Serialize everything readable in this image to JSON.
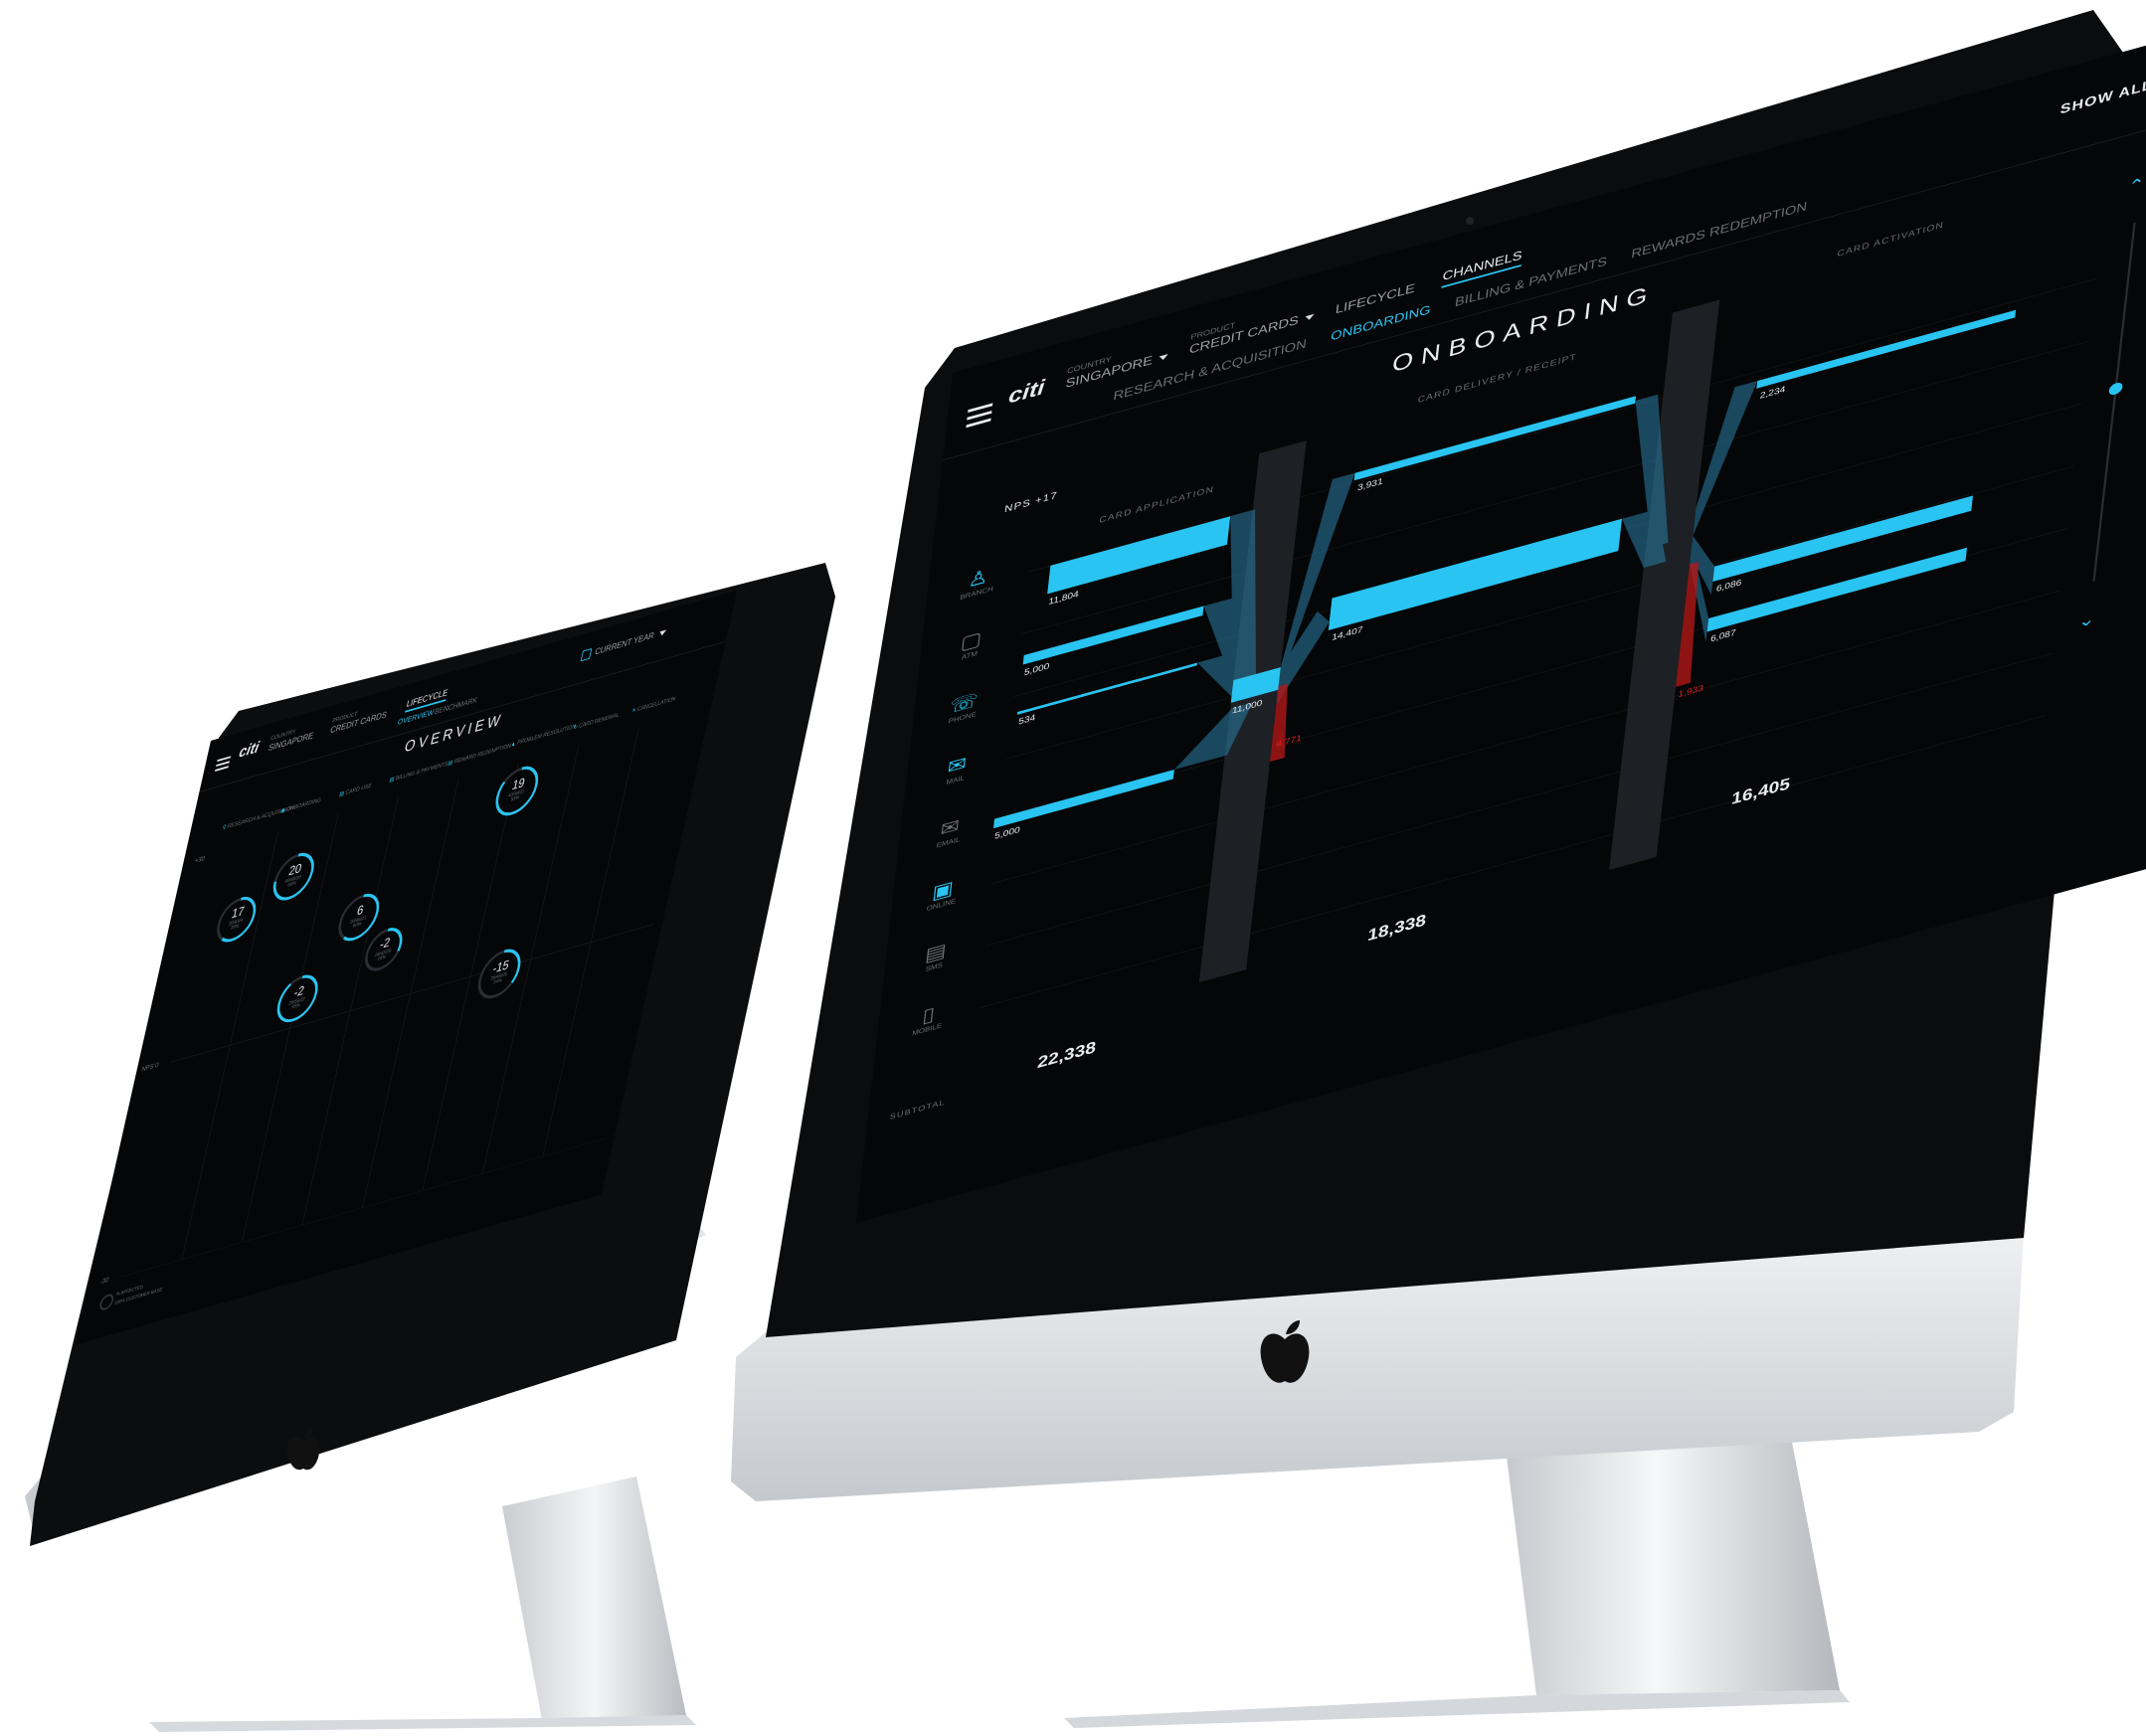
{
  "large": {
    "nav": {
      "country_label": "COUNTRY",
      "country_value": "SINGAPORE",
      "product_label": "PRODUCT",
      "product_value": "CREDIT CARDS",
      "lifecycle": "LIFECYCLE",
      "channels": "CHANNELS",
      "show_all": "SHOW ALL"
    },
    "tabs": [
      "RESEARCH & ACQUISITION",
      "ONBOARDING",
      "BILLING & PAYMENTS",
      "REWARDS REDEMPTION"
    ],
    "page_title": "ONBOARDING",
    "nps": "NPS +17",
    "stages": [
      "CARD APPLICATION",
      "CARD DELIVERY / RECEIPT",
      "CARD ACTIVATION"
    ],
    "channels": [
      {
        "icon": "branch-icon",
        "label": "BRANCH"
      },
      {
        "icon": "atm-icon",
        "label": "ATM"
      },
      {
        "icon": "phone-icon",
        "label": "PHONE"
      },
      {
        "icon": "mail-icon",
        "label": "MAIL"
      },
      {
        "icon": "email-icon",
        "label": "EMAIL"
      },
      {
        "icon": "online-icon",
        "label": "ONLINE"
      },
      {
        "icon": "sms-icon",
        "label": "SMS"
      },
      {
        "icon": "mobile-icon",
        "label": "MOBILE"
      }
    ],
    "bar_values": {
      "app_branch": "11,804",
      "app_phone": "5,000",
      "app_mail": "534",
      "app_online": "5,000",
      "app_pass": "11,000",
      "app_drop": "4,771",
      "delivery_top": "3,931",
      "delivery_main": "14,407",
      "act_branch": "2,234",
      "act_mid": "6,086",
      "act_low": "6,087",
      "act_drop": "1,933"
    },
    "subtotal_label": "SUBTOTAL",
    "subtotals": [
      "22,338",
      "18,338",
      "16,405"
    ],
    "colors": {
      "accent": "#29c4f2",
      "drop": "#e02020",
      "screen": "#050607"
    }
  },
  "small": {
    "nav": {
      "country_label": "COUNTRY",
      "country_value": "SINGAPORE",
      "product_label": "PRODUCT",
      "product_value": "CREDIT CARDS",
      "lifecycle": "LIFECYCLE",
      "period": "CURRENT YEAR"
    },
    "tabs": [
      "OVERVIEW",
      "BENCHMARK"
    ],
    "page_title": "OVERVIEW",
    "stages": [
      "RESEARCH & ACQUISITION",
      "ONBOARDING",
      "CARD USE",
      "BILLING & PAYMENTS",
      "REWARD REDEMPTION",
      "PROBLEM RESOLUTION",
      "CARD RENEWAL",
      "CANCELLATION"
    ],
    "y_axis": [
      "+30",
      "NPS 0",
      "-30"
    ],
    "bubbles": [
      {
        "value": "17",
        "date": "20/63/9",
        "pct": "25%",
        "fill": 0.6
      },
      {
        "value": "20",
        "date": "40/40/20",
        "pct": "60%",
        "fill": 0.75
      },
      {
        "value": "6",
        "date": "20/46/21",
        "pct": "60%",
        "fill": 0.6
      },
      {
        "value": "-2",
        "date": "20/56/22",
        "pct": "95%",
        "fill": 0.9
      },
      {
        "value": "-2",
        "date": "18/42/20",
        "pct": "15%",
        "fill": 0.3
      },
      {
        "value": "19",
        "date": "40/39/21",
        "pct": "55%",
        "fill": 0.85
      },
      {
        "value": "-15",
        "date": "20/45/05",
        "pct": "24%",
        "fill": 0.35
      }
    ],
    "legend": [
      "% AFFECTED",
      "100% CUSTOMER BASE"
    ]
  }
}
